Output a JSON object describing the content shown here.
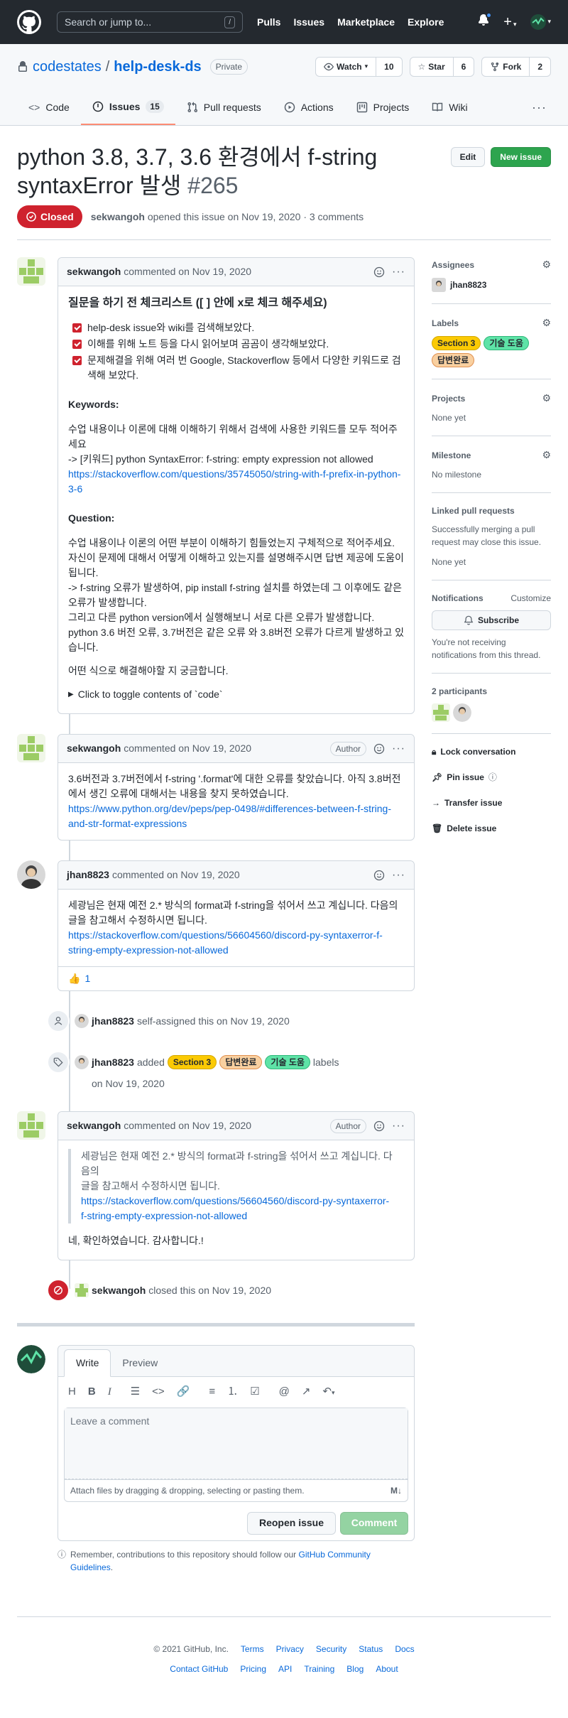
{
  "header": {
    "search_placeholder": "Search or jump to...",
    "slash": "/",
    "nav": [
      "Pulls",
      "Issues",
      "Marketplace",
      "Explore"
    ],
    "plus": "+",
    "caret": "▾"
  },
  "repo": {
    "owner": "codestates",
    "sep": "/",
    "name": "help-desk-ds",
    "visibility": "Private",
    "watch_label": "Watch",
    "watch_count": "10",
    "star_label": "Star",
    "star_count": "6",
    "fork_label": "Fork",
    "fork_count": "2"
  },
  "tabs": {
    "code": "Code",
    "issues": "Issues",
    "issues_count": "15",
    "pulls": "Pull requests",
    "actions": "Actions",
    "projects": "Projects",
    "wiki": "Wiki"
  },
  "issue": {
    "title": "python 3.8, 3.7, 3.6 환경에서 f-string syntaxError 발생",
    "number": "#265",
    "edit": "Edit",
    "new_issue": "New issue",
    "state": "Closed",
    "opener": "sekwangoh",
    "opened_text": "opened this issue on Nov 19, 2020 · 3 comments"
  },
  "comment1": {
    "author": "sekwangoh",
    "meta": "commented on Nov 19, 2020",
    "heading": "질문을 하기 전 체크리스트 ([ ] 안에 x로 체크 해주세요)",
    "checklist": [
      "help-desk issue와 wiki를 검색해보았다.",
      "이해를 위해 노트 등을 다시 읽어보며 곰곰이 생각해보았다.",
      "문제해결을 위해 여러 번 Google, Stackoverflow 등에서 다양한 키워드로 검색해 보았다."
    ],
    "keywords_title": "Keywords:",
    "keywords_desc": "수업 내용이나 이론에 대해 이해하기 위해서 검색에 사용한 키워드를 모두 적어주세요",
    "keywords_value": "-> [키워드] python SyntaxError: f-string: empty expression not allowed",
    "keywords_link": "https://stackoverflow.com/questions/35745050/string-with-f-prefix-in-python-3-6",
    "question_title": "Question:",
    "question_desc": "수업 내용이나 이론의 어떤 부분이 이해하기 힘들었는지 구체적으로 적어주세요. 자신이 문제에 대해서 어떻게 이해하고 있는지를 설명해주시면 답변 제공에 도움이 됩니다.",
    "question_l1": "-> f-string 오류가 발생하여, pip install f-string 설치를 하였는데 그 이후에도 같은 오류가 발생합니다.",
    "question_l2": "그리고 다른 python version에서 실행해보니 서로 다른 오류가 발생합니다.",
    "question_l3": "python 3.6 버전 오류, 3.7버전은 같은 오류 와 3.8버전 오류가 다르게 발생하고 있습니다.",
    "closing": "어떤 식으로 해결해야할 지 궁금합니다.",
    "toggle": "Click to toggle contents of `code`"
  },
  "comment2": {
    "author": "sekwangoh",
    "meta": "commented on Nov 19, 2020",
    "badge": "Author",
    "text": "3.6버전과 3.7버전에서 f-string '.format'에 대한 오류를 찾았습니다. 아직 3.8버전에서 생긴 오류에 대해서는 내용을 찾지 못하였습니다.",
    "link": "https://www.python.org/dev/peps/pep-0498/#differences-between-f-string-and-str-format-expressions"
  },
  "comment3": {
    "author": "jhan8823",
    "meta": "commented on Nov 19, 2020",
    "text": "세광님은 현재 예전 2.* 방식의 format과 f-string을 섞어서 쓰고 계십니다. 다음의 글을 참고해서 수정하시면 됩니다.",
    "link": "https://stackoverflow.com/questions/56604560/discord-py-syntaxerror-f-string-empty-expression-not-allowed",
    "reaction_emoji": "👍",
    "reaction_count": "1"
  },
  "event1": {
    "user": "jhan8823",
    "text": "self-assigned this on Nov 19, 2020"
  },
  "event2": {
    "user": "jhan8823",
    "added": "added",
    "labels_word": "labels",
    "date": "on Nov 19, 2020"
  },
  "labels": {
    "section": "Section 3",
    "answered": "답변완료",
    "tech": "기술 도움"
  },
  "comment4": {
    "author": "sekwangoh",
    "meta": "commented on Nov 19, 2020",
    "badge": "Author",
    "quote_l1": "세광님은 현재 예전 2.* 방식의 format과 f-string을 섞어서 쓰고 계십니다. 다음의",
    "quote_l2": "글을 참고해서 수정하시면 됩니다.",
    "quote_link": "https://stackoverflow.com/questions/56604560/discord-py-syntaxerror-f-string-empty-expression-not-allowed",
    "reply": "네, 확인하였습니다. 감사합니다.!"
  },
  "closed_event": {
    "user": "sekwangoh",
    "text": "closed this on Nov 19, 2020"
  },
  "editor": {
    "write_tab": "Write",
    "preview_tab": "Preview",
    "placeholder": "Leave a comment",
    "attach": "Attach files by dragging & dropping, selecting or pasting them.",
    "md": "M↓",
    "reopen": "Reopen issue",
    "comment": "Comment",
    "guidelines_text": "Remember, contributions to this repository should follow our",
    "guidelines_link": "GitHub Community Guidelines",
    "period": "."
  },
  "sidebar": {
    "assignees": "Assignees",
    "assignee": "jhan8823",
    "labels": "Labels",
    "projects": "Projects",
    "projects_value": "None yet",
    "milestone": "Milestone",
    "milestone_value": "No milestone",
    "linked": "Linked pull requests",
    "linked_desc": "Successfully merging a pull request may close this issue.",
    "linked_value": "None yet",
    "notifications": "Notifications",
    "customize": "Customize",
    "subscribe": "Subscribe",
    "notif_desc": "You're not receiving notifications from this thread.",
    "participants": "2 participants",
    "lock": "Lock conversation",
    "pin": "Pin issue",
    "transfer": "Transfer issue",
    "delete": "Delete issue"
  },
  "footer": {
    "copyright": "© 2021 GitHub, Inc.",
    "row1": [
      "Terms",
      "Privacy",
      "Security",
      "Status",
      "Docs"
    ],
    "row2": [
      "Contact GitHub",
      "Pricing",
      "API",
      "Training",
      "Blog",
      "About"
    ]
  },
  "colors": {
    "header_bg": "#24292f",
    "closed_red": "#cf222e",
    "primary_green": "#2da44e",
    "link_blue": "#0969da",
    "label_section": "#fbca04",
    "label_answered": "#f9d0a0",
    "label_tech": "#5ee3a7"
  }
}
